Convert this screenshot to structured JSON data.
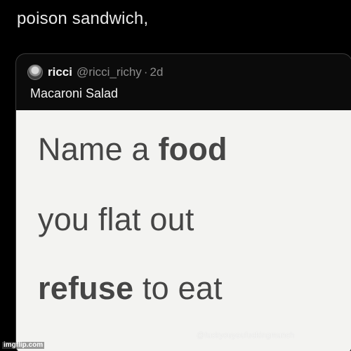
{
  "top_text": "poison sandwich,",
  "quoted_post": {
    "display_name": "ricci",
    "handle": "@ricci_richy",
    "separator": "·",
    "time": "2d",
    "reply_text": "Macaroni Salad",
    "image_text": {
      "line1_before": "Name a ",
      "line1_bold": "food",
      "line2": "you flat out",
      "line3_bold": "refuse",
      "line3_after": " to eat"
    },
    "watermark": "@fuckyouyoufuckingmunch"
  },
  "site_watermark": "imgflip.com",
  "colors": {
    "background": "#000000",
    "card_border": "#3a3a3a",
    "media_background": "#f3f3f1",
    "primary_text": "#e8e8e8",
    "secondary_text": "#8b8b8b",
    "image_text": "#454545"
  },
  "icons": {
    "avatar": "profile-avatar-icon"
  }
}
